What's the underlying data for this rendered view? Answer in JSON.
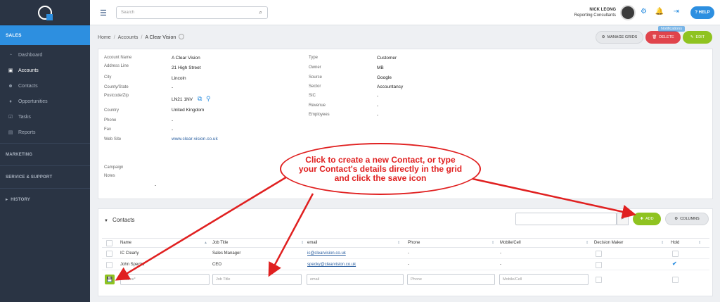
{
  "sidebar": {
    "section_sales": "SALES",
    "items": [
      {
        "label": "Dashboard",
        "icon": "dashboard-icon",
        "glyph": "◔"
      },
      {
        "label": "Accounts",
        "icon": "briefcase-icon",
        "glyph": "▣"
      },
      {
        "label": "Contacts",
        "icon": "people-icon",
        "glyph": "☻"
      },
      {
        "label": "Opportunities",
        "icon": "bulb-icon",
        "glyph": "♦"
      },
      {
        "label": "Tasks",
        "icon": "check-icon",
        "glyph": "☑"
      },
      {
        "label": "Reports",
        "icon": "report-icon",
        "glyph": "▤"
      }
    ],
    "section_marketing": "MARKETING",
    "section_service": "SERVICE & SUPPORT",
    "section_history": "HISTORY"
  },
  "header": {
    "search_placeholder": "Search",
    "user_name": "NICK LEONG",
    "user_company": "Reporting Consultants",
    "notifications_tip": "Notifications",
    "help_label": "HELP"
  },
  "breadcrumb": {
    "home": "Home",
    "accounts": "Accounts",
    "current": "A Clear Vision"
  },
  "actions": {
    "manage_grids": "MANAGE GRIDS",
    "delete": "DELETE",
    "edit": "EDIT"
  },
  "details": {
    "left": [
      {
        "label": "Account Name",
        "value": "A Clear Vision"
      },
      {
        "label": "Address Line",
        "value": "21 High Street"
      },
      {
        "label": "City",
        "value": "Lincoln"
      },
      {
        "label": "County/State",
        "value": "-"
      },
      {
        "label": "Postcode/Zip",
        "value": "LN21 1NV"
      },
      {
        "label": "Country",
        "value": "United Kingdom"
      },
      {
        "label": "Phone",
        "value": "-"
      },
      {
        "label": "Fax",
        "value": "-"
      },
      {
        "label": "Web Site",
        "value": "www.clear-vision.co.uk"
      }
    ],
    "right": [
      {
        "label": "Type",
        "value": "Customer"
      },
      {
        "label": "Owner",
        "value": "MB"
      },
      {
        "label": "Source",
        "value": "Google"
      },
      {
        "label": "Sector",
        "value": "Accountancy"
      },
      {
        "label": "SIC",
        "value": "-"
      },
      {
        "label": "Revenue",
        "value": "-"
      },
      {
        "label": "Employees",
        "value": "-"
      }
    ],
    "campaign_label": "Campaign",
    "notes_label": "Notes",
    "notes_value": "-"
  },
  "callout": {
    "text": "Click to create a new Contact, or type your Contact's details directly in the grid and click the save icon"
  },
  "contacts": {
    "title": "Contacts",
    "add_label": "ADD",
    "columns_label": "COLUMNS",
    "headers": [
      "Name",
      "Job Title",
      "email",
      "Phone",
      "Mobile/Cell",
      "Decision Maker",
      "Hold"
    ],
    "rows": [
      {
        "name": "IC Clearly",
        "job": "Sales Manager",
        "email": "ic@clearvision.co.uk",
        "phone": "-",
        "mobile": "-",
        "hold": false
      },
      {
        "name": "John Specks",
        "job": "CEO",
        "email": "specky@clearvision.co.uk",
        "phone": "-",
        "mobile": "-",
        "hold": true
      }
    ],
    "placeholders": {
      "name": "Name*",
      "job": "Job Title",
      "email": "email",
      "phone": "Phone",
      "mobile": "Mobile/Cell"
    }
  },
  "colors": {
    "accent": "#2d8fe0",
    "sidebar": "#2a3444",
    "green": "#8fc320",
    "red": "#e0444c",
    "callout": "#e02020"
  }
}
